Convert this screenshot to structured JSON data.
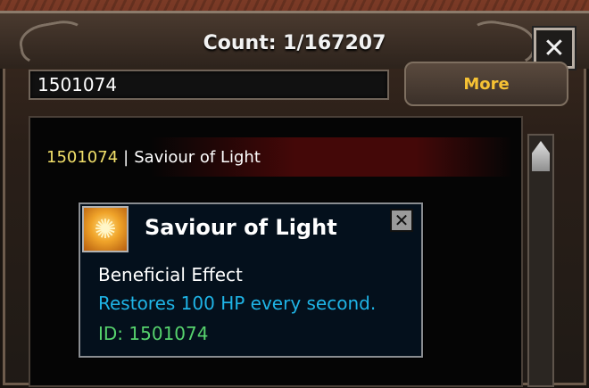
{
  "window": {
    "title": "Count: 1/167207"
  },
  "search": {
    "value": "1501074"
  },
  "buttons": {
    "more_label": "More",
    "close_glyph": "✕"
  },
  "list": [
    {
      "id": "1501074",
      "separator": "|",
      "name": "Saviour of Light"
    }
  ],
  "tooltip": {
    "icon": "sun-wings-icon",
    "title": "Saviour of Light",
    "effect_type": "Beneficial Effect",
    "description": "Restores 100 HP every second.",
    "id_line": "ID: 1501074"
  },
  "colors": {
    "title_text": "#f2f2f2",
    "more_text": "#f6c234",
    "row_id": "#f2e06a",
    "description": "#1fb4e6",
    "id_text": "#56d26d"
  }
}
